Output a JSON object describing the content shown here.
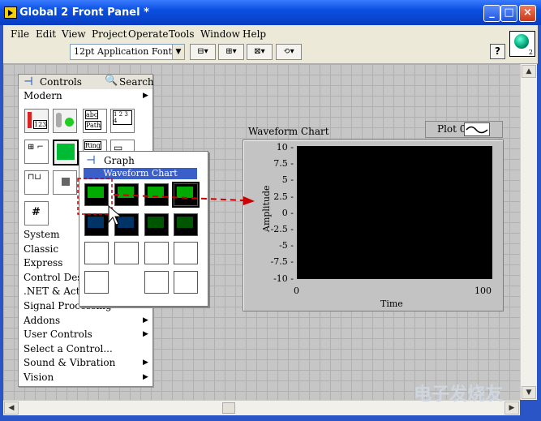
{
  "window": {
    "title": "Global 2 Front Panel *",
    "buttons": [
      "_",
      "□",
      "×"
    ]
  },
  "menu": [
    {
      "label": "File",
      "u": "F"
    },
    {
      "label": "Edit",
      "u": "E"
    },
    {
      "label": "View",
      "u": "V"
    },
    {
      "label": "Project",
      "u": "P"
    },
    {
      "label": "Operate",
      "u": "O"
    },
    {
      "label": "Tools",
      "u": "T"
    },
    {
      "label": "Window",
      "u": "W"
    },
    {
      "label": "Help",
      "u": "H"
    }
  ],
  "toolbar": {
    "font": "12pt Application Font",
    "help": "?",
    "vi_icon_number": "2"
  },
  "palette": {
    "title": "Controls",
    "search": "Search",
    "section": "Modern",
    "tile_labels": {
      "numeric": "123",
      "string_abc": "abc",
      "string_path": "Path",
      "array_cells": "1 2 3 4",
      "ring": "Ring",
      "enum_hash": "#"
    },
    "categories": [
      "System",
      "Classic",
      "Express",
      "Control Design",
      ".NET & ActiveX",
      "Signal Processing",
      "Addons",
      "User Controls",
      "Select a Control...",
      "Sound & Vibration",
      "Vision"
    ]
  },
  "graph_palette": {
    "title": "Graph",
    "tooltip": "Waveform Chart"
  },
  "chart": {
    "label": "Waveform Chart",
    "legend": "Plot 0",
    "ylabel": "Amplitude",
    "xlabel": "Time",
    "yticks": [
      "10 -",
      "7.5 -",
      "5 -",
      "2.5 -",
      "0 -",
      "-2.5 -",
      "-5 -",
      "-7.5 -",
      "-10 -"
    ],
    "xticks": [
      "0",
      "100"
    ]
  },
  "watermark": "电子发烧友",
  "colors": {
    "titlebar": "#0a4fe0",
    "plot_bg": "#000000",
    "highlight": "#3a5fc9",
    "arrow": "#cc0000"
  }
}
